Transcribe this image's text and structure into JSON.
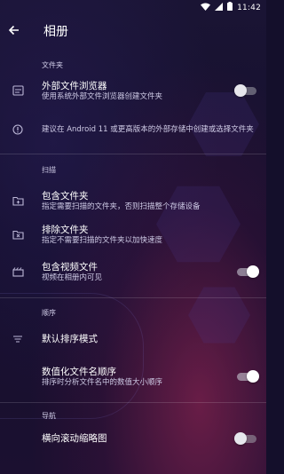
{
  "status_bar": {
    "time": "11:42",
    "icons": [
      "wifi-icon",
      "signal-icon",
      "battery-icon"
    ]
  },
  "toolbar": {
    "title": "相册",
    "back_icon": "back-arrow-icon"
  },
  "sections": {
    "folders": "文件夹",
    "scan": "扫描",
    "sort": "顺序",
    "nav": "导航"
  },
  "items": {
    "external_browser": {
      "title": "外部文件浏览器",
      "subtitle": "使用系统外部文件浏览器创建文件夹",
      "toggle": false
    },
    "android11_note": {
      "text": "建议在 Android 11 或更高版本的外部存储中创建或选择文件夹"
    },
    "include_folders": {
      "title": "包含文件夹",
      "subtitle": "指定需要扫描的文件夹，否则扫描整个存储设备"
    },
    "exclude_folders": {
      "title": "排除文件夹",
      "subtitle": "指定不需要扫描的文件夹以加快速度"
    },
    "include_videos": {
      "title": "包含视频文件",
      "subtitle": "视频在相册内可见",
      "toggle": true
    },
    "default_sort": {
      "title": "默认排序模式"
    },
    "numeric_sort": {
      "title": "数值化文件名顺序",
      "subtitle": "排序时分析文件名中的数值大小顺序",
      "toggle": true
    },
    "horizontal_scroll": {
      "title": "横向滚动缩略图",
      "toggle": false
    }
  },
  "colors": {
    "background": "#140f2b",
    "accent": "#a8285a"
  }
}
